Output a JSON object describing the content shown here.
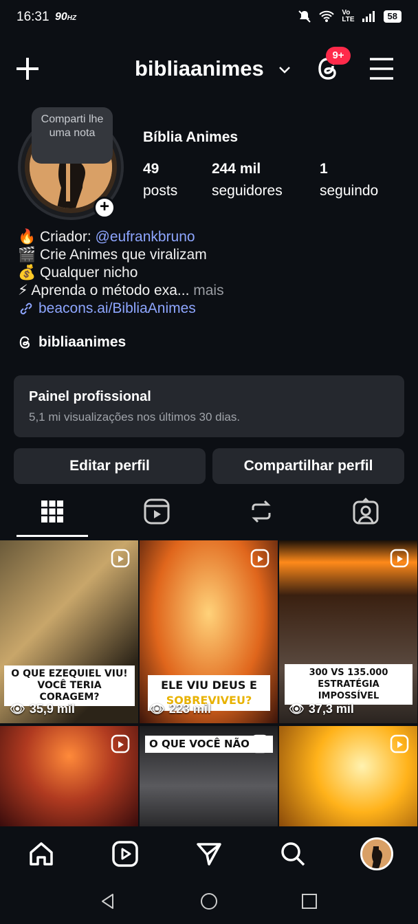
{
  "status": {
    "time": "16:31",
    "hz": "90",
    "battery": "58"
  },
  "header": {
    "username": "bibliaanimes",
    "notif_badge": "9+"
  },
  "profile": {
    "note": "Comparti lhe uma nota",
    "display_name": "Bíblia Animes",
    "posts_count": "49",
    "posts_label": "posts",
    "followers_count": "244 mil",
    "followers_label": "seguidores",
    "following_count": "1",
    "following_label": "seguindo",
    "bio_line1_prefix": "🔥 Criador: ",
    "bio_mention": "@eufrankbruno",
    "bio_line2": "🎬 Crie Animes que viralizam",
    "bio_line3": "💰 Qualquer nicho",
    "bio_line4": "⚡ Aprenda o método exa...",
    "bio_more": " mais",
    "link": "beacons.ai/BibliaAnimes",
    "threads_handle": "bibliaanimes"
  },
  "panel": {
    "title": "Painel profissional",
    "subtitle": "5,1 mi visualizações nos últimos 30 dias."
  },
  "actions": {
    "edit": "Editar perfil",
    "share": "Compartilhar perfil"
  },
  "posts": [
    {
      "caption_a": "O QUE EZEQUIEL VIU!",
      "caption_b": "VOCÊ TERIA CORAGEM?",
      "views": "35,9 mil"
    },
    {
      "caption_a": "ELE VIU DEUS E",
      "caption_b": "SOBREVIVEU?",
      "views": "223 mil"
    },
    {
      "caption_a": "300 VS 135.000",
      "caption_b": "ESTRATÉGIA IMPOSSÍVEL",
      "views": "37,3 mil"
    },
    {
      "caption_a": "",
      "caption_b": "",
      "views": ""
    },
    {
      "caption_a": "O QUE VOCÊ NÃO",
      "caption_b": "",
      "views": ""
    },
    {
      "caption_a": "",
      "caption_b": "",
      "views": ""
    }
  ],
  "colors": {
    "bg": "#0c0f14",
    "card": "#25282e",
    "link": "#8ea6ff",
    "badge": "#ff2a4a"
  }
}
